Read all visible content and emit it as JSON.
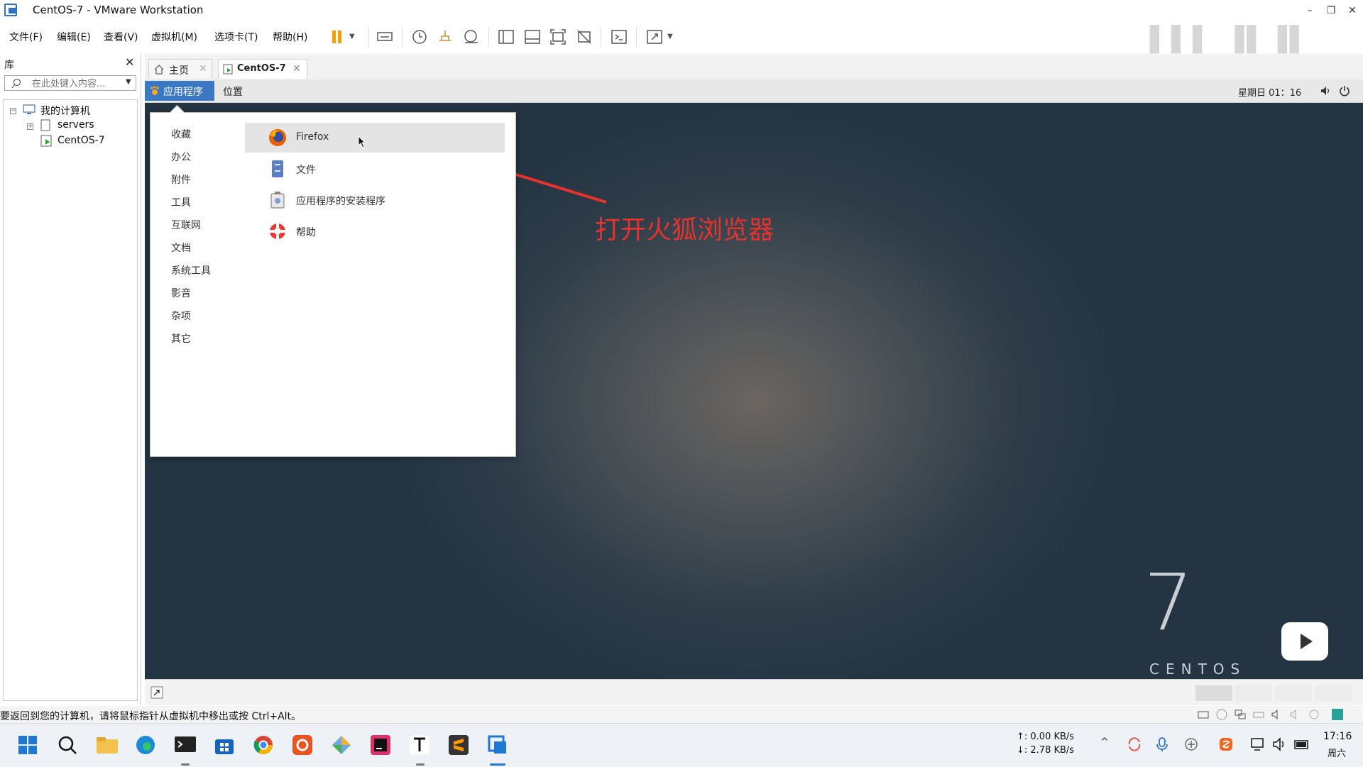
{
  "window": {
    "title": "CentOS-7 - VMware Workstation"
  },
  "menu": [
    "文件(F)",
    "编辑(E)",
    "查看(V)",
    "虚拟机(M)",
    "选项卡(T)",
    "帮助(H)"
  ],
  "library": {
    "title": "库",
    "search_placeholder": "在此处键入内容...",
    "tree": {
      "root": "我的计算机",
      "children": [
        "servers",
        "CentOS-7"
      ]
    }
  },
  "tabs": [
    {
      "label": "主页"
    },
    {
      "label": "CentOS-7"
    }
  ],
  "guest": {
    "top_bar": {
      "applications": "应用程序",
      "places": "位置",
      "clock": "星期日 01：16"
    },
    "categories": [
      "收藏",
      "办公",
      "附件",
      "工具",
      "互联网",
      "文档",
      "系统工具",
      "影音",
      "杂项",
      "其它"
    ],
    "apps": [
      "Firefox",
      "文件",
      "应用程序的安装程序",
      "帮助"
    ],
    "annotation": "打开火狐浏览器",
    "centos": {
      "number": "7",
      "text": "CENTOS"
    }
  },
  "statusbar": {
    "hint": "要返回到您的计算机，请将鼠标指针从虚拟机中移出或按 Ctrl+Alt。"
  },
  "taskbar": {
    "net_up": "↑: 0.00 KB/s",
    "net_down": "↓: 2.78 KB/s",
    "time": "17:16",
    "day": "周六"
  },
  "colors": {
    "accent": "#3b78c4",
    "annotation": "#e8322e",
    "pause": "#f0a000"
  }
}
